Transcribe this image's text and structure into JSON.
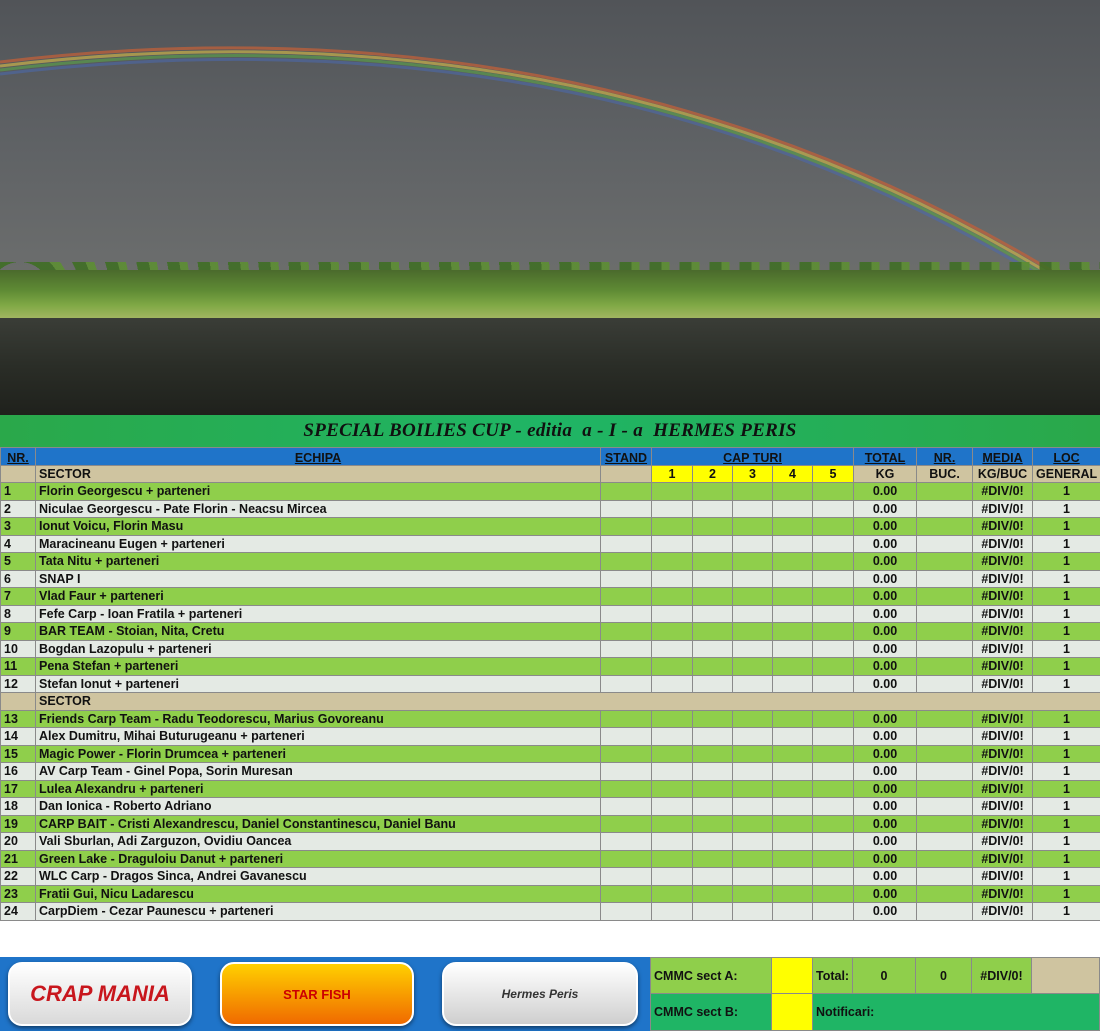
{
  "title": "SPECIAL BOILIES CUP - editia  a - I - a  HERMES PERIS",
  "headers": {
    "nr": "NR.",
    "echipa": "ECHIPA",
    "stand": "STAND",
    "capturi": "CAP  TURI",
    "total": "TOTAL",
    "nr2": "NR.",
    "media": "MEDIA",
    "loc": "LOC"
  },
  "subheaders": {
    "sector": "SECTOR",
    "cols": [
      "1",
      "2",
      "3",
      "4",
      "5"
    ],
    "kg": "KG",
    "buc": "BUC.",
    "kgbuc": "KG/BUC",
    "general": "GENERAL"
  },
  "sector2_label": "SECTOR",
  "sectorA": [
    {
      "nr": "1",
      "team": "Florin Georgescu + parteneri",
      "total": "0.00",
      "media": "#DIV/0!",
      "loc": "1"
    },
    {
      "nr": "2",
      "team": "Niculae Georgescu - Pate Florin - Neacsu Mircea",
      "total": "0.00",
      "media": "#DIV/0!",
      "loc": "1"
    },
    {
      "nr": "3",
      "team": "Ionut Voicu, Florin Masu",
      "total": "0.00",
      "media": "#DIV/0!",
      "loc": "1"
    },
    {
      "nr": "4",
      "team": "Maracineanu Eugen + parteneri",
      "total": "0.00",
      "media": "#DIV/0!",
      "loc": "1"
    },
    {
      "nr": "5",
      "team": "Tata Nitu + parteneri",
      "total": "0.00",
      "media": "#DIV/0!",
      "loc": "1"
    },
    {
      "nr": "6",
      "team": "SNAP I",
      "total": "0.00",
      "media": "#DIV/0!",
      "loc": "1"
    },
    {
      "nr": "7",
      "team": "Vlad Faur + parteneri",
      "total": "0.00",
      "media": "#DIV/0!",
      "loc": "1"
    },
    {
      "nr": "8",
      "team": "Fefe Carp - Ioan Fratila + parteneri",
      "total": "0.00",
      "media": "#DIV/0!",
      "loc": "1"
    },
    {
      "nr": "9",
      "team": "BAR TEAM - Stoian, Nita, Cretu",
      "total": "0.00",
      "media": "#DIV/0!",
      "loc": "1"
    },
    {
      "nr": "10",
      "team": "Bogdan Lazopulu + parteneri",
      "total": "0.00",
      "media": "#DIV/0!",
      "loc": "1"
    },
    {
      "nr": "11",
      "team": "Pena Stefan + parteneri",
      "total": "0.00",
      "media": "#DIV/0!",
      "loc": "1"
    },
    {
      "nr": "12",
      "team": "Stefan Ionut + parteneri",
      "total": "0.00",
      "media": "#DIV/0!",
      "loc": "1"
    }
  ],
  "sectorB": [
    {
      "nr": "13",
      "team": "Friends Carp Team - Radu Teodorescu, Marius Govoreanu",
      "total": "0.00",
      "media": "#DIV/0!",
      "loc": "1"
    },
    {
      "nr": "14",
      "team": "Alex Dumitru, Mihai Buturugeanu + parteneri",
      "total": "0.00",
      "media": "#DIV/0!",
      "loc": "1"
    },
    {
      "nr": "15",
      "team": "Magic Power - Florin Drumcea + parteneri",
      "total": "0.00",
      "media": "#DIV/0!",
      "loc": "1"
    },
    {
      "nr": "16",
      "team": "AV Carp Team - Ginel Popa, Sorin Muresan",
      "total": "0.00",
      "media": "#DIV/0!",
      "loc": "1"
    },
    {
      "nr": "17",
      "team": "Lulea Alexandru + parteneri",
      "total": "0.00",
      "media": "#DIV/0!",
      "loc": "1"
    },
    {
      "nr": "18",
      "team": "Dan Ionica - Roberto Adriano",
      "total": "0.00",
      "media": "#DIV/0!",
      "loc": "1"
    },
    {
      "nr": "19",
      "team": "CARP BAIT -  Cristi Alexandrescu, Daniel Constantinescu, Daniel Banu",
      "total": "0.00",
      "media": "#DIV/0!",
      "loc": "1"
    },
    {
      "nr": "20",
      "team": "Vali Sburlan, Adi Zarguzon, Ovidiu Oancea",
      "total": "0.00",
      "media": "#DIV/0!",
      "loc": "1"
    },
    {
      "nr": "21",
      "team": "Green Lake - Draguloiu Danut + parteneri",
      "total": "0.00",
      "media": "#DIV/0!",
      "loc": "1"
    },
    {
      "nr": "22",
      "team": "WLC Carp - Dragos Sinca, Andrei Gavanescu",
      "total": "0.00",
      "media": "#DIV/0!",
      "loc": "1"
    },
    {
      "nr": "23",
      "team": "Fratii Gui, Nicu Ladarescu",
      "total": "0.00",
      "media": "#DIV/0!",
      "loc": "1"
    },
    {
      "nr": "24",
      "team": "CarpDiem - Cezar Paunescu + parteneri",
      "total": "0.00",
      "media": "#DIV/0!",
      "loc": "1"
    }
  ],
  "footer": {
    "logo1": "CRAP MANIA",
    "logo2": "STAR FISH",
    "logo3": "Hermes Peris",
    "cmmc_a": "CMMC sect A:",
    "cmmc_b": "CMMC sect B:",
    "total_label": "Total:",
    "total_kg": "0",
    "total_buc": "0",
    "total_media": "#DIV/0!",
    "notificari": "Notificari:"
  },
  "colors": {
    "green_row": "#8fcf4b",
    "light_row": "#e4eae4",
    "header_blue": "#1f74c9",
    "yellow": "#ffff00",
    "tan": "#cfc4a0"
  }
}
